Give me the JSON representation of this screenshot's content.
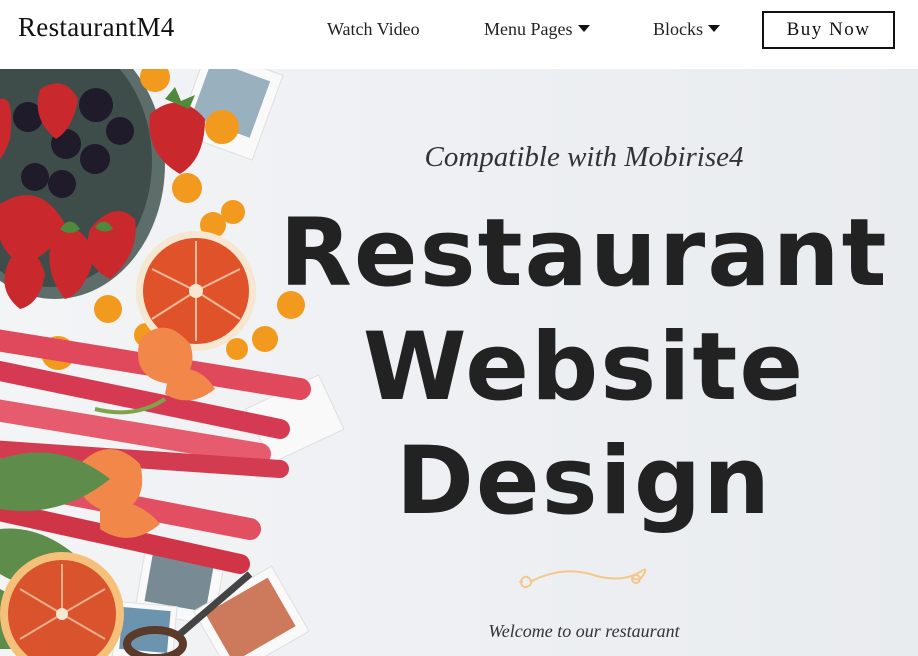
{
  "navbar": {
    "brand": "RestaurantM4",
    "links": [
      {
        "label": "Watch Video"
      },
      {
        "label": "Menu Pages"
      },
      {
        "label": "Blocks"
      }
    ],
    "cta_label": "Buy Now"
  },
  "hero": {
    "subtitle": "Compatible with Mobirise4",
    "title_lines": [
      "Restaurant",
      "Website",
      "Design"
    ],
    "welcome": "Welcome to our restaurant"
  },
  "colors": {
    "text_dark": "#222222",
    "ornament": "#f3c98b",
    "background": "#eef0f3"
  },
  "icons": [
    "caret-down-icon",
    "divider-ornament-icon"
  ]
}
